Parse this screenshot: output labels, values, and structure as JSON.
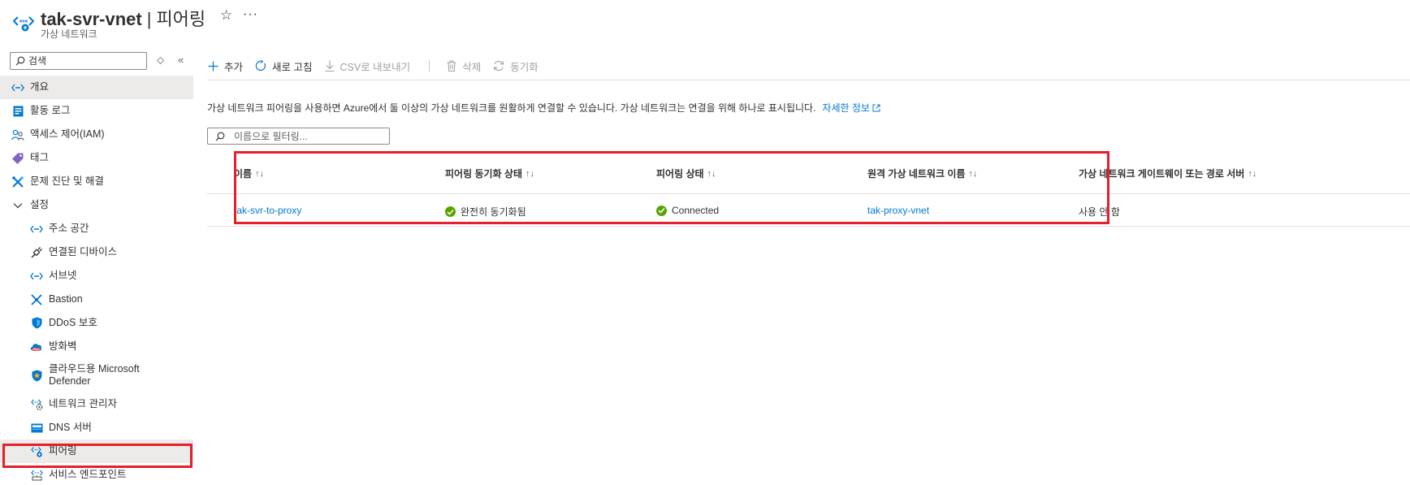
{
  "header": {
    "resource_name": "tak-svr-vnet",
    "separator": "|",
    "page_title": "피어링",
    "subtitle": "가상 네트워크",
    "favorite_icon": "star-icon",
    "more_icon": "ellipsis-icon",
    "more_label": "···"
  },
  "sidebar": {
    "search_placeholder": "검색",
    "items": [
      {
        "label": "개요",
        "icon": "overview-icon",
        "level": 0
      },
      {
        "label": "활동 로그",
        "icon": "activity-log-icon",
        "level": 0
      },
      {
        "label": "액세스 제어(IAM)",
        "icon": "people-icon",
        "level": 0
      },
      {
        "label": "태그",
        "icon": "tag-icon",
        "level": 0
      },
      {
        "label": "문제 진단 및 해결",
        "icon": "wrench-icon",
        "level": 0
      },
      {
        "label": "설정",
        "icon": "chevron-down-icon",
        "level": 0
      },
      {
        "label": "주소 공간",
        "icon": "address-space-icon",
        "level": 1
      },
      {
        "label": "연결된 디바이스",
        "icon": "plug-icon",
        "level": 1
      },
      {
        "label": "서브넷",
        "icon": "subnet-icon",
        "level": 1
      },
      {
        "label": "Bastion",
        "icon": "bastion-icon",
        "level": 1
      },
      {
        "label": "DDoS 보호",
        "icon": "shield-icon",
        "level": 1
      },
      {
        "label": "방화벽",
        "icon": "firewall-icon",
        "level": 1
      },
      {
        "label": "클라우드용 Microsoft Defender",
        "icon": "defender-icon",
        "level": 1
      },
      {
        "label": "네트워크 관리자",
        "icon": "network-manager-icon",
        "level": 1
      },
      {
        "label": "DNS 서버",
        "icon": "dns-icon",
        "level": 1
      },
      {
        "label": "피어링",
        "icon": "peering-icon",
        "level": 1,
        "active": true
      },
      {
        "label": "서비스 엔드포인트",
        "icon": "service-endpoint-icon",
        "level": 1
      }
    ]
  },
  "toolbar": {
    "add": "추가",
    "refresh": "새로 고침",
    "export_csv": "CSV로 내보내기",
    "delete": "삭제",
    "sync": "동기화"
  },
  "info": {
    "text": "가상 네트워크 피어링을 사용하면 Azure에서 둘 이상의 가상 네트워크를 원활하게 연결할 수 있습니다. 가상 네트워크는 연결을 위해 하나로 표시됩니다.",
    "link": "자세한 정보"
  },
  "filter": {
    "placeholder": "이름으로 필터링..."
  },
  "table": {
    "columns": [
      "이름",
      "피어링 동기화 상태",
      "피어링 상태",
      "원격 가상 네트워크 이름",
      "가상 네트워크 게이트웨이 또는 경로 서버"
    ],
    "sort_glyph": "↑↓",
    "rows": [
      {
        "name": "tak-svr-to-proxy",
        "sync_status": "완전히 동기화됨",
        "peering_status": "Connected",
        "remote_vnet": "tak-proxy-vnet",
        "gateway": "사용 안 함"
      }
    ]
  },
  "colors": {
    "accent": "#0078d4",
    "highlight": "#e51f2b",
    "success": "#57a300"
  }
}
